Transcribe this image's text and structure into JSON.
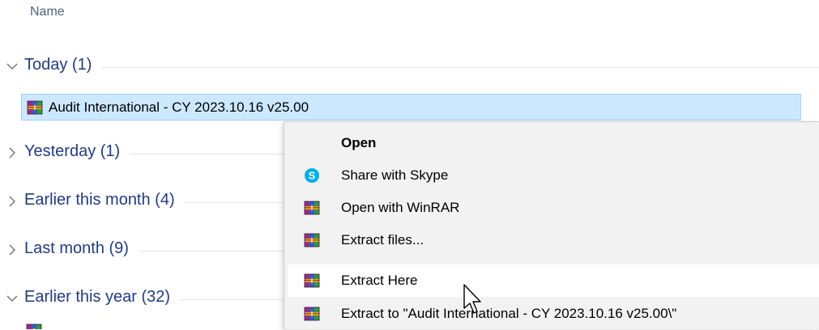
{
  "header": {
    "name_column": "Name"
  },
  "groups": [
    {
      "label": "Today (1)",
      "expanded": true
    },
    {
      "label": "Yesterday (1)",
      "expanded": false
    },
    {
      "label": "Earlier this month (4)",
      "expanded": false
    },
    {
      "label": "Last month (9)",
      "expanded": false
    },
    {
      "label": "Earlier this year (32)",
      "expanded": true
    }
  ],
  "file": {
    "name": "Audit International - CY 2023.10.16 v25.00",
    "icon": "winrar-archive-icon"
  },
  "context_menu": {
    "items": [
      {
        "label": "Open",
        "icon": "none",
        "bold": true
      },
      {
        "label": "Share with Skype",
        "icon": "skype-icon"
      },
      {
        "label": "Open with WinRAR",
        "icon": "winrar-icon"
      },
      {
        "label": "Extract files...",
        "icon": "winrar-icon"
      },
      {
        "label": "Extract Here",
        "icon": "winrar-icon",
        "hovered": true
      },
      {
        "label": "Extract to \"Audit International - CY 2023.10.16 v25.00\\\"",
        "icon": "winrar-icon"
      }
    ]
  },
  "colors": {
    "group_label": "#1e3b8c",
    "selection_bg": "#cce8ff",
    "selection_border": "#99d1ff",
    "menu_bg": "#f2f2f2",
    "skype_blue": "#00aff0"
  }
}
